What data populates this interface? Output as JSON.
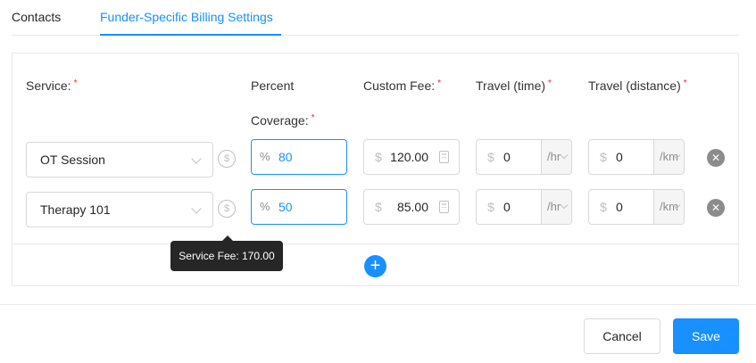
{
  "tabs": [
    {
      "label": "Contacts",
      "active": false
    },
    {
      "label": "Funder-Specific Billing Settings",
      "active": true
    }
  ],
  "columns": {
    "service": "Service:",
    "percent_coverage_line1": "Percent",
    "percent_coverage_line2": "Coverage:",
    "custom_fee": "Custom Fee:",
    "travel_time": "Travel (time)",
    "travel_distance": "Travel (distance)",
    "required_mark": "*"
  },
  "rows": [
    {
      "service": "OT Session",
      "service_icon": "$",
      "percent_prefix": "%",
      "percent": "80",
      "fee_prefix": "$",
      "fee": "120.00",
      "time_prefix": "$",
      "time_value": "0",
      "time_unit": "/hr",
      "distance_prefix": "$",
      "distance_value": "0",
      "distance_unit": "/km",
      "remove_icon": "✕"
    },
    {
      "service": "Therapy 101",
      "service_icon": "$",
      "percent_prefix": "%",
      "percent": "50",
      "fee_prefix": "$",
      "fee": "85.00",
      "time_prefix": "$",
      "time_value": "0",
      "time_unit": "/hr",
      "distance_prefix": "$",
      "distance_value": "0",
      "distance_unit": "/km",
      "remove_icon": "✕"
    }
  ],
  "tooltip": {
    "text": "Service Fee: 170.00"
  },
  "add_row": {
    "icon": "+"
  },
  "footer": {
    "cancel_label": "Cancel",
    "save_label": "Save"
  },
  "colors": {
    "accent": "#1890ff",
    "required": "#f5222d",
    "tooltip_bg": "#262626"
  }
}
